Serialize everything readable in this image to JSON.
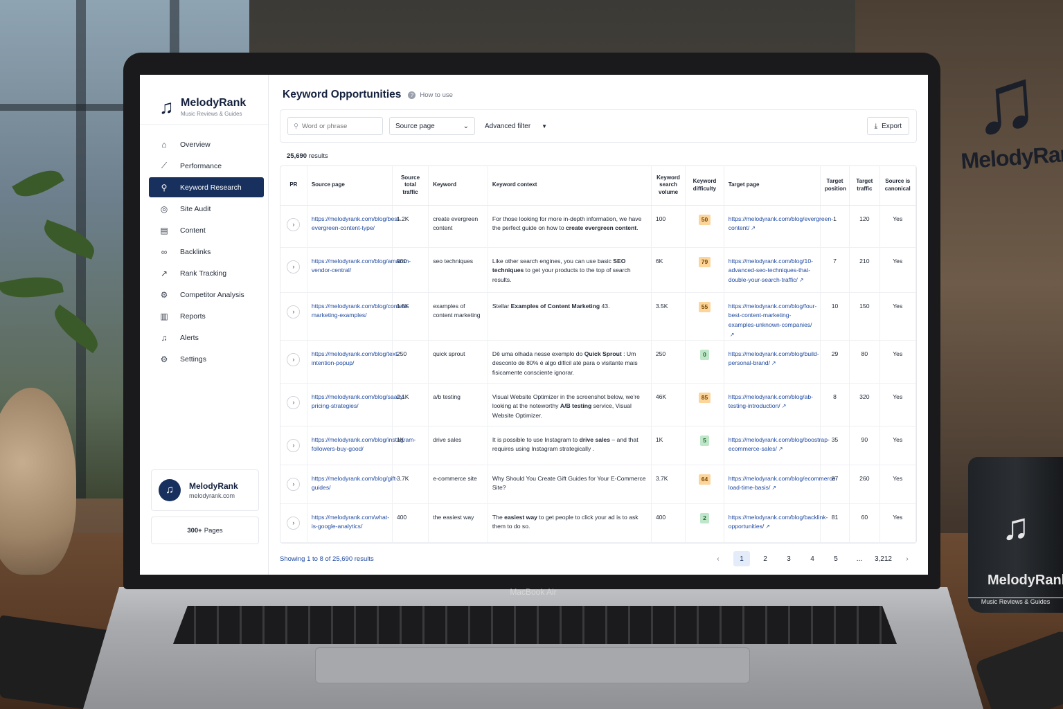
{
  "brand": {
    "name": "MelodyRank",
    "tagline": "Music Reviews & Guides"
  },
  "device_label": "MacBook Air",
  "mug": {
    "brand": "MelodyRank",
    "tagline": "Music Reviews & Guides"
  },
  "wall_sign": "MelodyRank",
  "sidebar": {
    "items": [
      {
        "label": "Overview",
        "icon": "home-icon"
      },
      {
        "label": "Performance",
        "icon": "chart-line-icon"
      },
      {
        "label": "Keyword Research",
        "icon": "search-icon",
        "active": true
      },
      {
        "label": "Site Audit",
        "icon": "audit-icon"
      },
      {
        "label": "Content",
        "icon": "document-icon"
      },
      {
        "label": "Backlinks",
        "icon": "link-icon"
      },
      {
        "label": "Rank Tracking",
        "icon": "rank-icon"
      },
      {
        "label": "Competitor Analysis",
        "icon": "competitor-icon"
      },
      {
        "label": "Reports",
        "icon": "report-icon"
      },
      {
        "label": "Alerts",
        "icon": "bell-icon"
      },
      {
        "label": "Settings",
        "icon": "gear-icon"
      }
    ],
    "site": {
      "name": "MelodyRank",
      "domain": "melodyrank.com"
    },
    "pages": {
      "count": "300+",
      "label": "Pages"
    }
  },
  "header": {
    "title": "Keyword Opportunities",
    "help_label": "How to use"
  },
  "filters": {
    "search_placeholder": "Word or phrase",
    "source_select": "Source page",
    "advanced_label": "Advanced filter",
    "export_label": "Export"
  },
  "results": {
    "count": "25,690",
    "label": "results"
  },
  "table": {
    "headers": {
      "pr": "PR",
      "source_page": "Source page",
      "source_traffic": "Source total traffic",
      "keyword": "Keyword",
      "context": "Keyword context",
      "volume": "Keyword search volume",
      "difficulty": "Keyword difficulty",
      "target_page": "Target page",
      "target_position": "Target position",
      "target_traffic": "Target traffic",
      "canonical": "Source is canonical"
    },
    "rows": [
      {
        "source": "https://melodyrank.com/blog/best-evergreen-content-type/",
        "traffic": "1.2K",
        "keyword": "create evergreen content",
        "ctx_pre": "For those looking for more in-depth information, we have the perfect guide on how to ",
        "ctx_bold": "create evergreen content",
        "ctx_post": ".",
        "volume": "100",
        "kd": "50",
        "kd_color": "orange",
        "target": "https://melodyrank.com/blog/evergreen-content/",
        "position": "1",
        "ttraffic": "120",
        "canonical": "Yes"
      },
      {
        "source": "https://melodyrank.com/blog/amazon-vendor-central/",
        "traffic": "900",
        "keyword": "seo techniques",
        "ctx_pre": "Like other search engines, you can use basic ",
        "ctx_bold": "SEO techniques",
        "ctx_post": " to get your products to the top of search results.",
        "volume": "6K",
        "kd": "79",
        "kd_color": "orange",
        "target": "https://melodyrank.com/blog/10-advanced-seo-techniques-that-double-your-search-traffic/",
        "position": "7",
        "ttraffic": "210",
        "canonical": "Yes"
      },
      {
        "source": "https://melodyrank.com/blog/content-marketing-examples/",
        "traffic": "1.5K",
        "keyword": "examples of content marketing",
        "ctx_pre": "Stellar ",
        "ctx_bold": "Examples of Content Marketing",
        "ctx_post": " 43.",
        "volume": "3.5K",
        "kd": "55",
        "kd_color": "orange",
        "target": "https://melodyrank.com/blog/four-best-content-marketing-examples-unknown-companies/",
        "position": "10",
        "ttraffic": "150",
        "canonical": "Yes"
      },
      {
        "source": "https://melodyrank.com/blog/text-intention-popup/",
        "traffic": "250",
        "keyword": "quick sprout",
        "ctx_pre": "Dê uma olhada nesse exemplo do ",
        "ctx_bold": "Quick Sprout",
        "ctx_post": " : Um desconto de 80% é algo difícil até para o visitante mais fisicamente consciente ignorar.",
        "volume": "250",
        "kd": "0",
        "kd_color": "green",
        "target": "https://melodyrank.com/blog/build-personal-brand/",
        "position": "29",
        "ttraffic": "80",
        "canonical": "Yes"
      },
      {
        "source": "https://melodyrank.com/blog/saasy-pricing-strategies/",
        "traffic": "2.1K",
        "keyword": "a/b testing",
        "ctx_pre": "Visual Website Optimizer in the screenshot below, we're looking at the noteworthy ",
        "ctx_bold": "A/B testing",
        "ctx_post": " service, Visual Website Optimizer.",
        "volume": "46K",
        "kd": "85",
        "kd_color": "orange",
        "target": "https://melodyrank.com/blog/ab-testing-introduction/",
        "position": "8",
        "ttraffic": "320",
        "canonical": "Yes"
      },
      {
        "source": "https://melodyrank.com/blog/instagram-followers-buy-good/",
        "traffic": "1K",
        "keyword": "drive sales",
        "ctx_pre": "It is possible to use Instagram to ",
        "ctx_bold": "drive sales",
        "ctx_post": " – and that requires using Instagram strategically .",
        "volume": "1K",
        "kd": "5",
        "kd_color": "green",
        "target": "https://melodyrank.com/blog/boostrap-ecommerce-sales/",
        "position": "35",
        "ttraffic": "90",
        "canonical": "Yes"
      },
      {
        "source": "https://melodyrank.com/blog/gift-guides/",
        "traffic": "3.7K",
        "keyword": "e-commerce site",
        "ctx_pre": "Why Should You Create Gift Guides for Your E-Commerce Site?",
        "ctx_bold": "",
        "ctx_post": "",
        "volume": "3.7K",
        "kd": "64",
        "kd_color": "orange",
        "target": "https://melodyrank.com/blog/ecommerce-load-time-basis/",
        "position": "87",
        "ttraffic": "260",
        "canonical": "Yes"
      },
      {
        "source": "https://melodyrank.com/what-is-google-analytics/",
        "traffic": "400",
        "keyword": "the easiest way",
        "ctx_pre": "The ",
        "ctx_bold": "easiest way",
        "ctx_post": " to get people to click your ad is to ask them to do so.",
        "volume": "400",
        "kd": "2",
        "kd_color": "green",
        "target": "https://melodyrank.com/blog/backlink-opportunities/",
        "position": "81",
        "ttraffic": "60",
        "canonical": "Yes"
      }
    ]
  },
  "footer": {
    "showing": "Showing 1 to 8 of 25,690 results",
    "pages": [
      "1",
      "2",
      "3",
      "4",
      "5",
      "...",
      "3,212"
    ],
    "current_page": "1"
  }
}
